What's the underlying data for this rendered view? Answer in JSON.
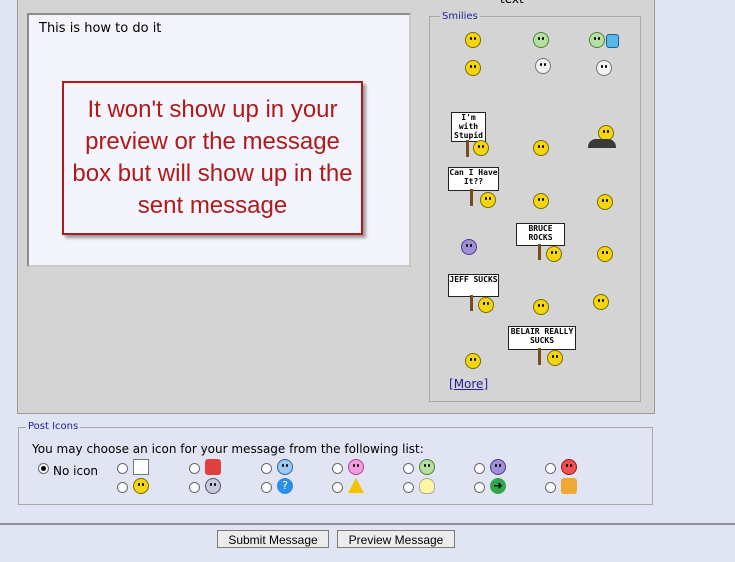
{
  "editor": {
    "message_text": "This is how to do it",
    "note_text": "It won't show up in your preview or the message box but will show up in the sent message"
  },
  "smilies": {
    "caption_top": "text",
    "legend": "Smilies",
    "signs": {
      "stupid": "I'm with Stupid",
      "can_i": "Can I Have It??",
      "bruce": "BRUCE ROCKS",
      "jeff": "JEFF SUCKS",
      "belair": "BELAIR REALLY SUCKS"
    },
    "more_open": "[",
    "more_label": "More",
    "more_close": "]"
  },
  "post_icons": {
    "legend": "Post Icons",
    "hint": "You may choose an icon for your message from the following list:",
    "no_icon_label": "No icon",
    "selected": "No icon"
  },
  "footer": {
    "submit_label": "Submit Message",
    "preview_label": "Preview Message"
  }
}
